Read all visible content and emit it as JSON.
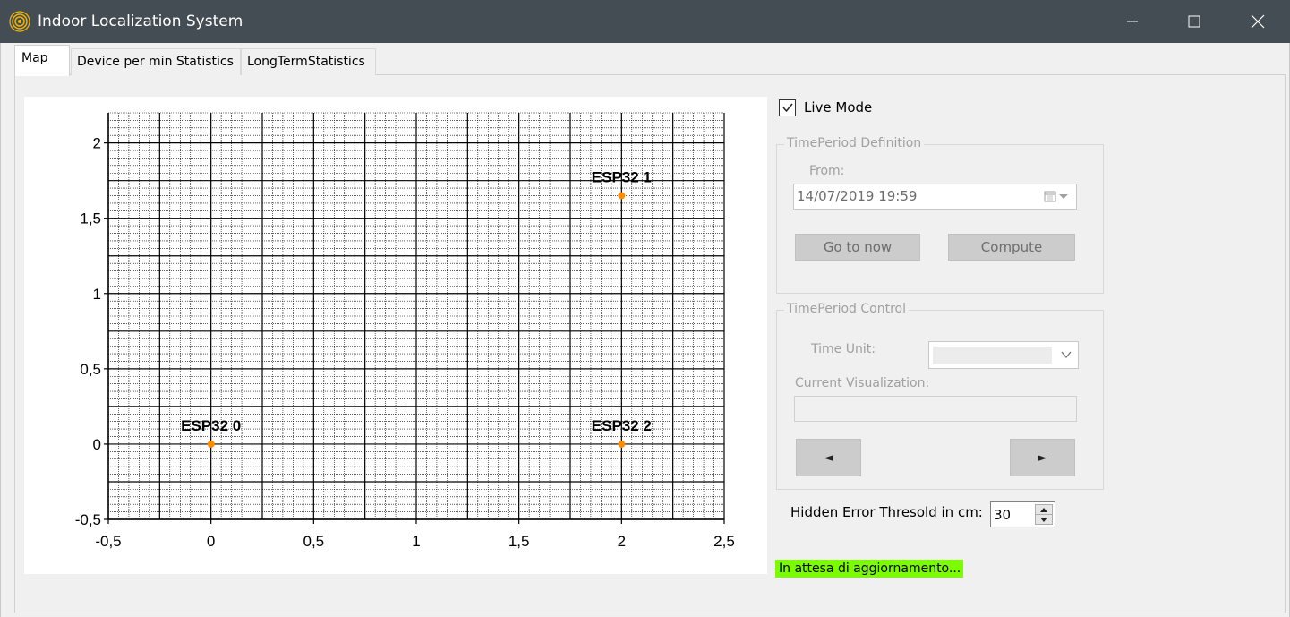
{
  "window": {
    "title": "Indoor Localization System",
    "app_icon": "wifi-signal-icon",
    "controls": [
      "minimize-icon",
      "maximize-icon",
      "close-icon"
    ]
  },
  "tabs": [
    {
      "label": "Map",
      "active": true
    },
    {
      "label": "Device per min Statistics",
      "active": false
    },
    {
      "label": "LongTermStatistics",
      "active": false
    }
  ],
  "controls": {
    "live_mode": {
      "label": "Live Mode",
      "checked": true
    },
    "time_period_definition": {
      "title": "TimePeriod Definition",
      "from_label": "From:",
      "from_value": "14/07/2019 19:59",
      "go_to_now_label": "Go to now",
      "compute_label": "Compute"
    },
    "time_period_control": {
      "title": "TimePeriod Control",
      "time_unit_label": "Time Unit:",
      "time_unit_value": "",
      "current_visualization_label": "Current Visualization:",
      "current_visualization_value": "",
      "prev_label": "◄",
      "next_label": "►"
    },
    "threshold": {
      "label": "Hidden Error Thresold in cm:",
      "value": "30"
    },
    "status_text": "In attesa di aggiornamento...",
    "status_color": "#7cfc00"
  },
  "chart_data": {
    "type": "scatter",
    "xlim": [
      -0.5,
      2.5
    ],
    "ylim": [
      -0.5,
      2.2
    ],
    "x_ticks": [
      "-0,5",
      "0",
      "0,5",
      "1",
      "1,5",
      "2",
      "2,5"
    ],
    "y_ticks": [
      "-0,5",
      "0",
      "0,5",
      "1",
      "1,5",
      "2"
    ],
    "grid": true,
    "point_color": "#ff8c00",
    "points": [
      {
        "label": "ESP32 0",
        "x": 0,
        "y": 0
      },
      {
        "label": "ESP32 1",
        "x": 2,
        "y": 1.65
      },
      {
        "label": "ESP32 2",
        "x": 2,
        "y": 0
      }
    ]
  }
}
